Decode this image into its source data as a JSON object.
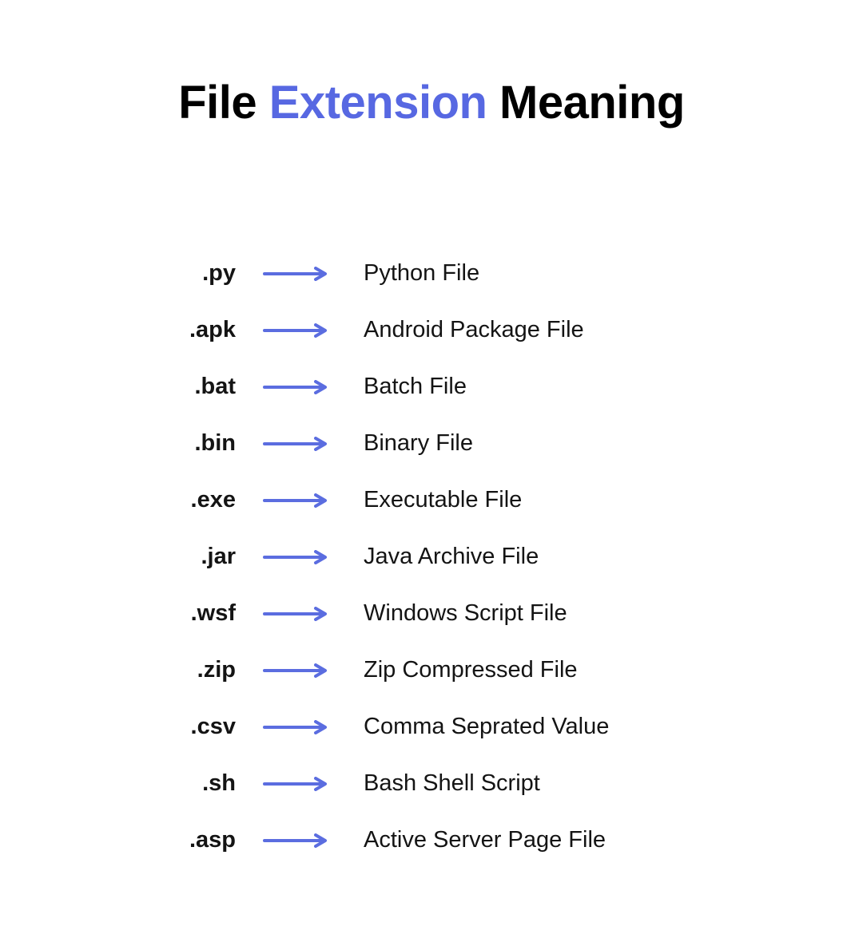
{
  "title": {
    "part1": "File ",
    "highlight": "Extension",
    "part2": " Meaning"
  },
  "extensions": [
    {
      "ext": ".py",
      "meaning": "Python File"
    },
    {
      "ext": ".apk",
      "meaning": "Android Package File"
    },
    {
      "ext": ".bat",
      "meaning": "Batch File"
    },
    {
      "ext": ".bin",
      "meaning": "Binary File"
    },
    {
      "ext": ".exe",
      "meaning": "Executable File"
    },
    {
      "ext": ".jar",
      "meaning": "Java Archive File"
    },
    {
      "ext": ".wsf",
      "meaning": "Windows Script File"
    },
    {
      "ext": ".zip",
      "meaning": "Zip Compressed File"
    },
    {
      "ext": ".csv",
      "meaning": "Comma Seprated Value"
    },
    {
      "ext": ".sh",
      "meaning": "Bash Shell Script"
    },
    {
      "ext": ".asp",
      "meaning": "Active Server Page File"
    }
  ]
}
